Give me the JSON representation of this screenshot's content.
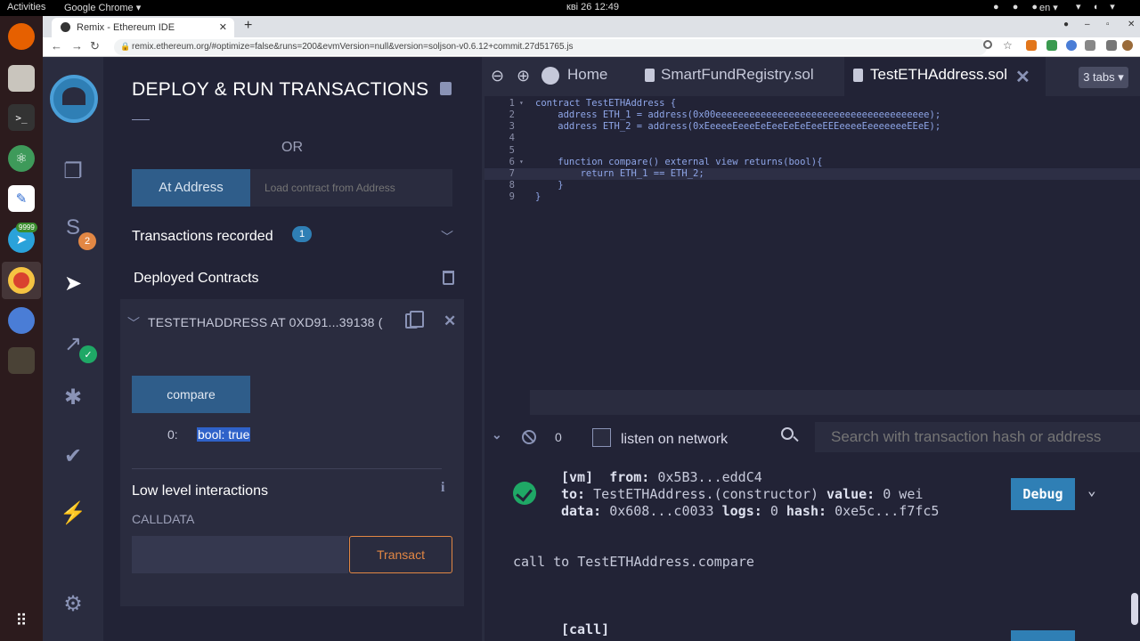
{
  "os": {
    "activities": "Activities",
    "app_menu": "Google Chrome ▾",
    "clock": "кві 26  12:49",
    "lang": "en ▾",
    "dock_badge": "9999"
  },
  "browser": {
    "tab_title": "Remix - Ethereum IDE",
    "new_tab": "+",
    "url": "remix.ethereum.org/#optimize=false&runs=200&evmVersion=null&version=soljson-v0.6.12+commit.27d51765.js"
  },
  "icon_panel": {
    "udapp_badge": "2"
  },
  "side_panel": {
    "title": "DEPLOY & RUN TRANSACTIONS",
    "or_label": "OR",
    "at_address_label": "At Address",
    "at_address_placeholder": "Load contract from Address",
    "transactions_recorded_label": "Transactions recorded",
    "transactions_recorded_count": "1",
    "deployed_contracts_label": "Deployed Contracts",
    "contract_title": "TESTETHADDRESS AT 0XD91...39138 (",
    "compare_label": "compare",
    "output_index": "0:",
    "output_value": "bool: true",
    "low_level_label": "Low level interactions",
    "calldata_label": "CALLDATA",
    "transact_label": "Transact"
  },
  "editor_tabs": {
    "home": "Home",
    "tab1": "SmartFundRegistry.sol",
    "tab2": "TestETHAddress.sol",
    "tabs_count": "3 tabs ▾"
  },
  "editor": {
    "lines": [
      {
        "n": "1",
        "code": "contract TestETHAddress {"
      },
      {
        "n": "2",
        "code": "    address ETH_1 = address(0x00eeeeeeeeeeeeeeeeeeeeeeeeeeeeeeeeeeeeee);"
      },
      {
        "n": "3",
        "code": "    address ETH_2 = address(0xEeeeeEeeeEeEeeEeEeEeeEEEeeeeEeeeeeeeEEeE);"
      },
      {
        "n": "4",
        "code": ""
      },
      {
        "n": "5",
        "code": ""
      },
      {
        "n": "6",
        "code": "    function compare() external view returns(bool){"
      },
      {
        "n": "7",
        "code": "        return ETH_1 == ETH_2;"
      },
      {
        "n": "8",
        "code": "    }"
      },
      {
        "n": "9",
        "code": "}"
      }
    ]
  },
  "terminal": {
    "pending_count": "0",
    "listen_label": "listen on network",
    "search_placeholder": "Search with transaction hash or address",
    "line1_prefix": "[vm]",
    "line1_from_key": "from:",
    "line1_from_val": "0x5B3...eddC4",
    "line2_to_key": "to:",
    "line2_to_val": "TestETHAddress.(constructor)",
    "line2_value_key": "value:",
    "line2_value_val": "0 wei",
    "line3_data_key": "data:",
    "line3_data_val": "0x608...c0033",
    "line3_logs_key": "logs:",
    "line3_logs_val": "0",
    "line3_hash_key": "hash:",
    "line3_hash_val": "0xe5c...f7fc5",
    "debug_label": "Debug",
    "call_line": "call to TestETHAddress.compare",
    "call_header": "[call]"
  }
}
